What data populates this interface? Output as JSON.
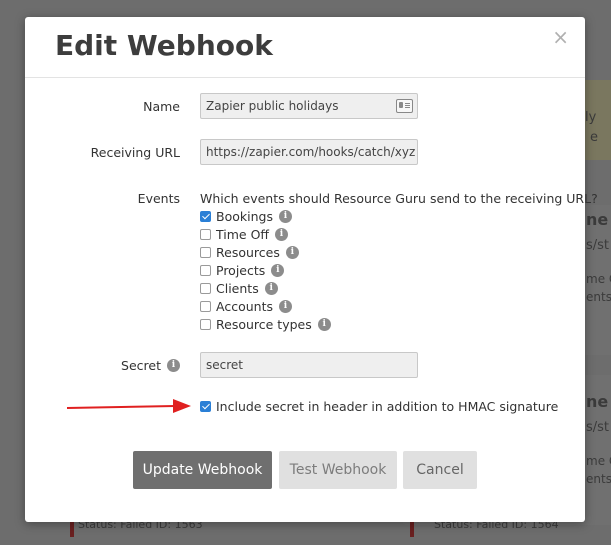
{
  "background": {
    "cards": [
      {
        "title": "ne C",
        "line1": "s/st",
        "line2": "me C",
        "line3": "ents"
      },
      {
        "title": "ne C",
        "line1": "s/st",
        "line2": "me C",
        "line3": "ents"
      }
    ],
    "left_peek_1": "ly",
    "left_peek_2": "e",
    "status_left": "Status: Failed   ID: 1563",
    "status_right": "Status: Failed   ID: 1564"
  },
  "modal": {
    "title": "Edit Webhook",
    "close_symbol": "×",
    "name_label": "Name",
    "name_value": "Zapier public holidays",
    "url_label": "Receiving URL",
    "url_value": "https://zapier.com/hooks/catch/xyz",
    "events_label": "Events",
    "events_question": "Which events should Resource Guru send to the receiving URL?",
    "events": [
      {
        "label": "Bookings",
        "checked": true
      },
      {
        "label": "Time Off",
        "checked": false
      },
      {
        "label": "Resources",
        "checked": false
      },
      {
        "label": "Projects",
        "checked": false
      },
      {
        "label": "Clients",
        "checked": false
      },
      {
        "label": "Accounts",
        "checked": false
      },
      {
        "label": "Resource types",
        "checked": false
      }
    ],
    "secret_label": "Secret",
    "secret_value": "secret",
    "include_secret_label": "Include secret in header in addition to HMAC signature",
    "include_secret_checked": true,
    "buttons": {
      "update": "Update Webhook",
      "test": "Test Webhook",
      "cancel": "Cancel"
    }
  },
  "colors": {
    "arrow": "#e02020",
    "checkbox_checked": "#2a7fd6",
    "primary_button": "#6f6f6f"
  },
  "icons": {
    "info": "info-icon",
    "contact_card": "contact-card-icon",
    "close": "close-icon"
  }
}
